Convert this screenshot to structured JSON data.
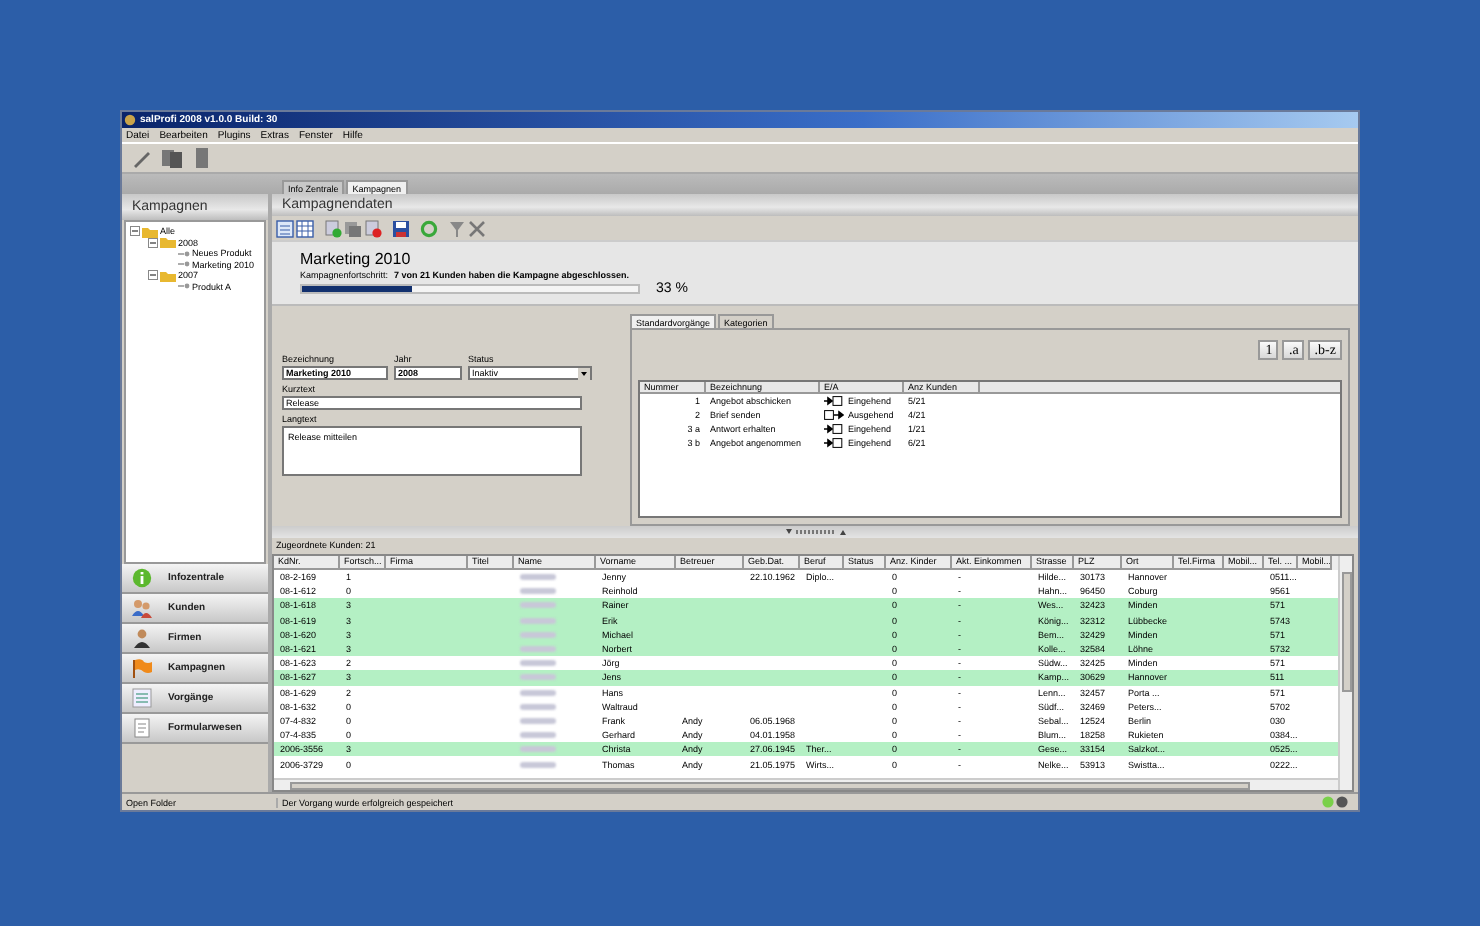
{
  "window": {
    "title": "salProfi 2008 v1.0.0 Build: 30"
  },
  "menu": [
    "Datei",
    "Bearbeiten",
    "Plugins",
    "Extras",
    "Fenster",
    "Hilfe"
  ],
  "tabs": [
    {
      "label": "Info Zentrale",
      "selected": false
    },
    {
      "label": "Kampagnen",
      "selected": true
    }
  ],
  "sidebar": {
    "title": "Kampagnen",
    "tree": [
      {
        "label": "Alle",
        "expanded": true,
        "children": [
          {
            "label": "2008",
            "expanded": true,
            "children": [
              {
                "label": "Neues Produkt"
              },
              {
                "label": "Marketing 2010"
              }
            ]
          },
          {
            "label": "2007",
            "expanded": true,
            "children": [
              {
                "label": "Produkt A"
              }
            ]
          }
        ]
      }
    ],
    "nav": [
      {
        "label": "Infozentrale",
        "kind": "info"
      },
      {
        "label": "Kunden",
        "kind": "people"
      },
      {
        "label": "Firmen",
        "kind": "person"
      },
      {
        "label": "Kampagnen",
        "kind": "flag"
      },
      {
        "label": "Vorgänge",
        "kind": "list"
      },
      {
        "label": "Formularwesen",
        "kind": "form"
      }
    ]
  },
  "campaign": {
    "header": "Kampagnendaten",
    "title": "Marketing 2010",
    "progress_label": "Kampagnenfortschritt:",
    "progress_text": "7 von 21 Kunden haben die Kampagne abgeschlossen.",
    "level": 0.33,
    "percent": "33 %",
    "name": {
      "label": "Bezeichnung",
      "value": "Marketing 2010"
    },
    "year": {
      "label": "Jahr",
      "value": "2008"
    },
    "status": {
      "label": "Status",
      "value": "Inaktiv"
    },
    "short_text": {
      "label": "Kurztext",
      "value": "Release"
    },
    "long_text": {
      "label": "Langtext",
      "value": "Release mitteilen"
    }
  },
  "steps": {
    "tabs": [
      {
        "label": "Standardvorgänge",
        "selected": true
      },
      {
        "label": "Kategorien",
        "selected": false
      }
    ],
    "buttons": [
      "1",
      ".a",
      ".b-z"
    ],
    "columns": [
      "Nummer",
      "Bezeichnung",
      "E/A",
      "Anz Kunden"
    ],
    "rows": [
      {
        "number": "1",
        "name": "Angebot abschicken",
        "kind": "in",
        "direction": "Eingehend",
        "count": "5/21"
      },
      {
        "number": "2",
        "name": "Brief senden",
        "kind": "out",
        "direction": "Ausgehend",
        "count": "4/21"
      },
      {
        "number": "3 a",
        "name": "Antwort erhalten",
        "kind": "in",
        "direction": "Eingehend",
        "count": "1/21"
      },
      {
        "number": "3 b",
        "name": "Angebot angenommen",
        "kind": "in",
        "direction": "Eingehend",
        "count": "6/21"
      }
    ]
  },
  "customers": {
    "label": "Zugeordnete Kunden: 21",
    "columns": [
      {
        "label": "KdNr."
      },
      {
        "label": "Fortsch..."
      },
      {
        "label": "Firma"
      },
      {
        "label": "Titel"
      },
      {
        "label": "Name",
        "redacted": true
      },
      {
        "label": "Vorname"
      },
      {
        "label": "Betreuer"
      },
      {
        "label": "Geb.Dat."
      },
      {
        "label": "Beruf"
      },
      {
        "label": "Status"
      },
      {
        "label": "Anz. Kinder"
      },
      {
        "label": "Akt. Einkommen"
      },
      {
        "label": "Strasse"
      },
      {
        "label": "PLZ"
      },
      {
        "label": "Ort"
      },
      {
        "label": "Tel.Firma"
      },
      {
        "label": "Mobil..."
      },
      {
        "label": "Tel. ..."
      },
      {
        "label": "Mobil..."
      }
    ],
    "rows": [
      {
        "highlighted": false,
        "cells": [
          "08-2-169",
          "1",
          null,
          null,
          null,
          "Jenny",
          null,
          "22.10.1962",
          "Diplo...",
          null,
          "0",
          "-",
          "Hilde...",
          "30173",
          "Hannover",
          null,
          null,
          "0511...",
          null
        ]
      },
      {
        "highlighted": false,
        "cells": [
          "08-1-612",
          "0",
          null,
          null,
          null,
          "Reinhold",
          null,
          null,
          null,
          null,
          "0",
          "-",
          "Hahn...",
          "96450",
          "Coburg",
          null,
          null,
          "9561",
          null
        ]
      },
      {
        "highlighted": true,
        "cells": [
          "08-1-618",
          "3",
          null,
          null,
          null,
          "Rainer",
          null,
          null,
          null,
          null,
          "0",
          "-",
          "Wes...",
          "32423",
          "Minden",
          null,
          null,
          "571",
          null
        ]
      },
      {
        "highlighted": true,
        "cells": [
          "08-1-619",
          "3",
          null,
          null,
          null,
          "Erik",
          null,
          null,
          null,
          null,
          "0",
          "-",
          "König...",
          "32312",
          "Lübbecke",
          null,
          null,
          "5743",
          null
        ]
      },
      {
        "highlighted": true,
        "cells": [
          "08-1-620",
          "3",
          null,
          null,
          null,
          "Michael",
          null,
          null,
          null,
          null,
          "0",
          "-",
          "Bem...",
          "32429",
          "Minden",
          null,
          null,
          "571",
          null
        ]
      },
      {
        "highlighted": true,
        "cells": [
          "08-1-621",
          "3",
          null,
          null,
          null,
          "Norbert",
          null,
          null,
          null,
          null,
          "0",
          "-",
          "Kolle...",
          "32584",
          "Löhne",
          null,
          null,
          "5732",
          null
        ]
      },
      {
        "highlighted": false,
        "cells": [
          "08-1-623",
          "2",
          null,
          null,
          null,
          "Jörg",
          null,
          null,
          null,
          null,
          "0",
          "-",
          "Südw...",
          "32425",
          "Minden",
          null,
          null,
          "571",
          null
        ]
      },
      {
        "highlighted": true,
        "cells": [
          "08-1-627",
          "3",
          null,
          null,
          null,
          "Jens",
          null,
          null,
          null,
          null,
          "0",
          "-",
          "Kamp...",
          "30629",
          "Hannover",
          null,
          null,
          "511",
          null
        ]
      },
      {
        "highlighted": false,
        "cells": [
          "08-1-629",
          "2",
          null,
          null,
          null,
          "Hans",
          null,
          null,
          null,
          null,
          "0",
          "-",
          "Lenn...",
          "32457",
          "Porta ...",
          null,
          null,
          "571",
          null
        ]
      },
      {
        "highlighted": false,
        "cells": [
          "08-1-632",
          "0",
          null,
          null,
          null,
          "Waltraud",
          null,
          null,
          null,
          null,
          "0",
          "-",
          "Südf...",
          "32469",
          "Peters...",
          null,
          null,
          "5702",
          null
        ]
      },
      {
        "highlighted": false,
        "cells": [
          "07-4-832",
          "0",
          null,
          null,
          null,
          "Frank",
          "Andy",
          "06.05.1968",
          null,
          null,
          "0",
          "-",
          "Sebal...",
          "12524",
          "Berlin",
          null,
          null,
          "030",
          null
        ]
      },
      {
        "highlighted": false,
        "cells": [
          "07-4-835",
          "0",
          null,
          null,
          null,
          "Gerhard",
          "Andy",
          "04.01.1958",
          null,
          null,
          "0",
          "-",
          "Blum...",
          "18258",
          "Rukieten",
          null,
          null,
          "0384...",
          null
        ]
      },
      {
        "highlighted": true,
        "cells": [
          "2006-3556",
          "3",
          null,
          null,
          null,
          "Christa",
          "Andy",
          "27.06.1945",
          "Ther...",
          null,
          "0",
          "-",
          "Gese...",
          "33154",
          "Salzkot...",
          null,
          null,
          "0525...",
          null
        ]
      },
      {
        "highlighted": false,
        "cells": [
          "2006-3729",
          "0",
          null,
          null,
          null,
          "Thomas",
          "Andy",
          "21.05.1975",
          "Wirts...",
          null,
          "0",
          "-",
          "Nelke...",
          "53913",
          "Swistta...",
          null,
          null,
          "0222...",
          null
        ]
      }
    ]
  },
  "status_bar": {
    "left": "Open Folder",
    "message": "Der Vorgang wurde erfolgreich gespeichert"
  }
}
